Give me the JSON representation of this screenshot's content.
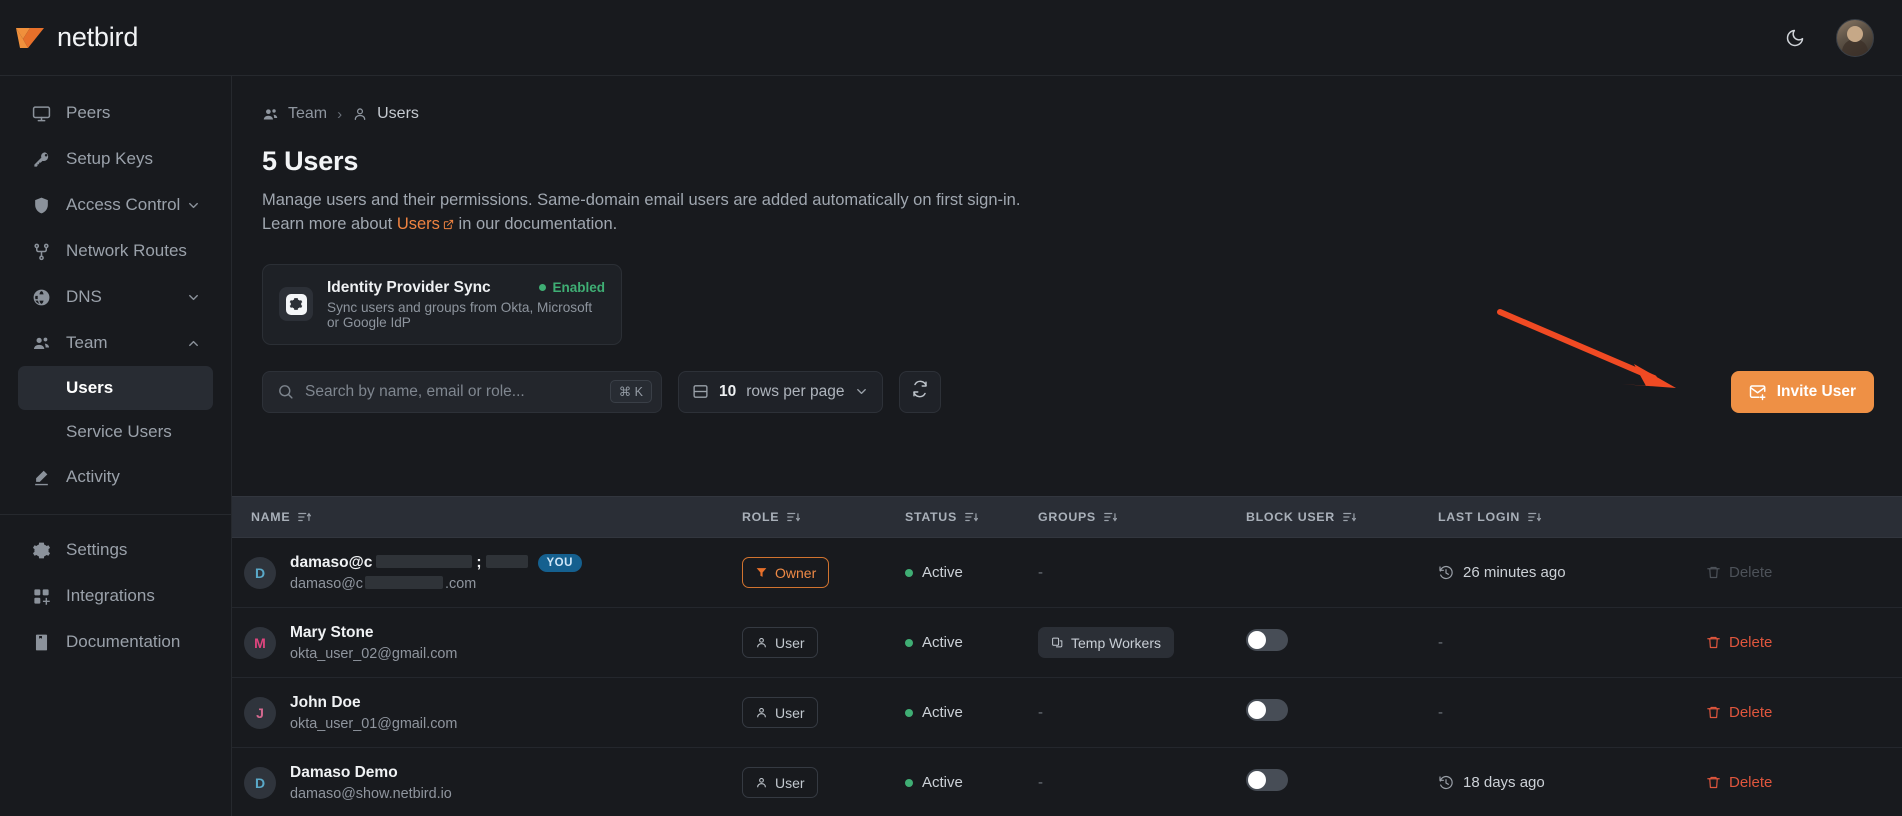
{
  "app": {
    "brand_name": "netbird",
    "theme_toggle_label": "dark-mode-toggle"
  },
  "sidebar": {
    "items": [
      {
        "label": "Peers",
        "icon": "monitor-icon",
        "expandable": false,
        "active": false
      },
      {
        "label": "Setup Keys",
        "icon": "key-icon",
        "expandable": false,
        "active": false
      },
      {
        "label": "Access Control",
        "icon": "shield-icon",
        "expandable": true,
        "active": false,
        "chevron": "chevron-down-icon"
      },
      {
        "label": "Network Routes",
        "icon": "route-icon",
        "expandable": false,
        "active": false
      },
      {
        "label": "DNS",
        "icon": "globe-icon",
        "expandable": true,
        "active": false,
        "chevron": "chevron-down-icon"
      },
      {
        "label": "Team",
        "icon": "users-icon",
        "expandable": true,
        "active": false,
        "chevron": "chevron-up-icon"
      }
    ],
    "team_children": [
      {
        "label": "Users",
        "active": true
      },
      {
        "label": "Service Users",
        "active": false
      }
    ],
    "items_after": [
      {
        "label": "Activity",
        "icon": "activity-icon",
        "expandable": false,
        "active": false
      }
    ],
    "items_bottom": [
      {
        "label": "Settings",
        "icon": "gear-icon",
        "active": false
      },
      {
        "label": "Integrations",
        "icon": "grid-plus-icon",
        "active": false
      },
      {
        "label": "Documentation",
        "icon": "book-icon",
        "active": false
      }
    ]
  },
  "breadcrumb": {
    "parent": "Team",
    "separator": "›",
    "current": "Users"
  },
  "page": {
    "title": "5 Users",
    "description_line1": "Manage users and their permissions. Same-domain email users are added automatically on first sign-in.",
    "description_line2_pre": "Learn more about ",
    "description_link": "Users",
    "description_line2_post": " in our documentation."
  },
  "idp_card": {
    "title": "Identity Provider Sync",
    "subtitle": "Sync users and groups from Okta, Microsoft or Google IdP",
    "status": "Enabled",
    "status_color": "#3fae74",
    "icon": "idp-sync-icon"
  },
  "toolbar": {
    "search_placeholder": "Search by name, email or role...",
    "search_value": "",
    "search_shortcut": "⌘ K",
    "rows_per_page_value": "10",
    "rows_per_page_suffix": "rows per page",
    "refresh_label": "refresh-icon",
    "invite_label": "Invite User",
    "invite_color": "#ee9045"
  },
  "annotation": {
    "arrow_color": "#f04a23",
    "arrow_name": "red-arrow-pointing-to-invite-user"
  },
  "table": {
    "columns": [
      {
        "key": "name",
        "label": "NAME",
        "sort": "sort-asc-icon"
      },
      {
        "key": "role",
        "label": "ROLE",
        "sort": "sort-desc-icon"
      },
      {
        "key": "status",
        "label": "STATUS",
        "sort": "sort-desc-icon"
      },
      {
        "key": "groups",
        "label": "GROUPS",
        "sort": "sort-desc-icon"
      },
      {
        "key": "block_user",
        "label": "BLOCK USER",
        "sort": "sort-desc-icon"
      },
      {
        "key": "last_login",
        "label": "LAST LOGIN",
        "sort": "sort-desc-icon"
      }
    ],
    "rows": [
      {
        "initial": "D",
        "initial_color": "#5aa9c9",
        "name": "damaso@c",
        "name_redacted": true,
        "name_suffix": ";",
        "is_you": true,
        "you_badge": "YOU",
        "email_prefix": "damaso@c",
        "email_redacted": true,
        "email_suffix": ".com",
        "role": "Owner",
        "role_style": "owner",
        "role_icon": "owner-flag-icon",
        "status": "Active",
        "groups": "-",
        "block_user": "none",
        "last_login": "26 minutes ago",
        "last_login_icon": "history-icon",
        "delete_label": "Delete",
        "delete_disabled": true
      },
      {
        "initial": "M",
        "initial_color": "#e0457f",
        "name": "Mary Stone",
        "name_redacted": false,
        "is_you": false,
        "email": "okta_user_02@gmail.com",
        "role": "User",
        "role_style": "user",
        "role_icon": "user-icon",
        "status": "Active",
        "groups": "Temp Workers",
        "groups_icon": "group-icon",
        "block_user": "toggle-off",
        "last_login": "-",
        "delete_label": "Delete",
        "delete_disabled": false
      },
      {
        "initial": "J",
        "initial_color": "#d3698f",
        "name": "John Doe",
        "name_redacted": false,
        "is_you": false,
        "email": "okta_user_01@gmail.com",
        "role": "User",
        "role_style": "user",
        "role_icon": "user-icon",
        "status": "Active",
        "groups": "-",
        "block_user": "toggle-off",
        "last_login": "-",
        "delete_label": "Delete",
        "delete_disabled": false
      },
      {
        "initial": "D",
        "initial_color": "#5aa9c9",
        "name": "Damaso Demo",
        "name_redacted": false,
        "is_you": false,
        "email": "damaso@show.netbird.io",
        "role": "User",
        "role_style": "user",
        "role_icon": "user-icon",
        "status": "Active",
        "groups": "-",
        "block_user": "toggle-off",
        "last_login": "18 days ago",
        "last_login_icon": "history-icon",
        "delete_label": "Delete",
        "delete_disabled": false
      }
    ]
  }
}
